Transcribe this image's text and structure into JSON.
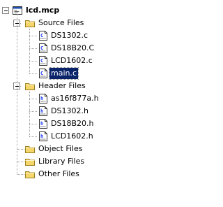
{
  "project": {
    "name": "lcd.mcp",
    "icon": "project-window-icon",
    "toggle_state": "expanded",
    "groups": [
      {
        "name": "Source Files",
        "icon": "folder-icon",
        "toggle_state": "expanded",
        "files": [
          {
            "name": "DS1302.c",
            "icon": "c-source-file-icon",
            "selected": false
          },
          {
            "name": "DS18B20.C",
            "icon": "c-source-file-icon",
            "selected": false
          },
          {
            "name": "LCD1602.c",
            "icon": "c-source-file-icon",
            "selected": false
          },
          {
            "name": "main.c",
            "icon": "c-source-file-icon",
            "selected": true
          }
        ]
      },
      {
        "name": "Header Files",
        "icon": "folder-icon",
        "toggle_state": "expanded",
        "files": [
          {
            "name": "as16f877a.h",
            "icon": "header-file-icon",
            "selected": false
          },
          {
            "name": "DS1302.h",
            "icon": "header-file-icon",
            "selected": false
          },
          {
            "name": "DS18B20.h",
            "icon": "header-file-icon",
            "selected": false
          },
          {
            "name": "LCD1602.h",
            "icon": "header-file-icon",
            "selected": false
          }
        ]
      },
      {
        "name": "Object Files",
        "icon": "folder-icon",
        "files": []
      },
      {
        "name": "Library Files",
        "icon": "folder-icon",
        "files": []
      },
      {
        "name": "Other Files",
        "icon": "folder-icon",
        "files": []
      }
    ]
  },
  "colors": {
    "selection_bg": "#0a246a",
    "folder_yellow": "#f5d66a",
    "tree_line": "#a0a0a0"
  }
}
